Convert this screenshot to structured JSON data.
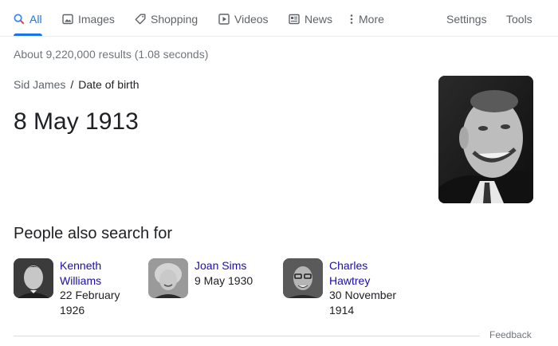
{
  "tabs": [
    {
      "label": "All",
      "icon": "search-icon",
      "active": true
    },
    {
      "label": "Images",
      "icon": "image-icon"
    },
    {
      "label": "Shopping",
      "icon": "tag-icon"
    },
    {
      "label": "Videos",
      "icon": "play-icon"
    },
    {
      "label": "News",
      "icon": "newspaper-icon"
    },
    {
      "label": "More",
      "icon": "more-vertical-icon"
    }
  ],
  "tools": {
    "settings_label": "Settings",
    "tools_label": "Tools"
  },
  "results_stats": "About 9,220,000 results (1.08 seconds)",
  "answer_card": {
    "entity": "Sid James",
    "separator": "/",
    "attribute": "Date of birth",
    "answer": "8 May 1913"
  },
  "people_also_search": {
    "title": "People also search for",
    "people": [
      {
        "name_line1": "Kenneth",
        "name_line2": "Williams",
        "date_line1": "22 February",
        "date_line2": "1926"
      },
      {
        "name_line1": "Joan Sims",
        "name_line2": "",
        "date_line1": "9 May 1930",
        "date_line2": ""
      },
      {
        "name_line1": "Charles",
        "name_line2": "Hawtrey",
        "date_line1": "30 November",
        "date_line2": "1914"
      }
    ]
  },
  "feedback_label": "Feedback",
  "colors": {
    "accent": "#1a73e8",
    "link": "#1a0dab",
    "text": "#202124",
    "muted": "#70757a"
  }
}
